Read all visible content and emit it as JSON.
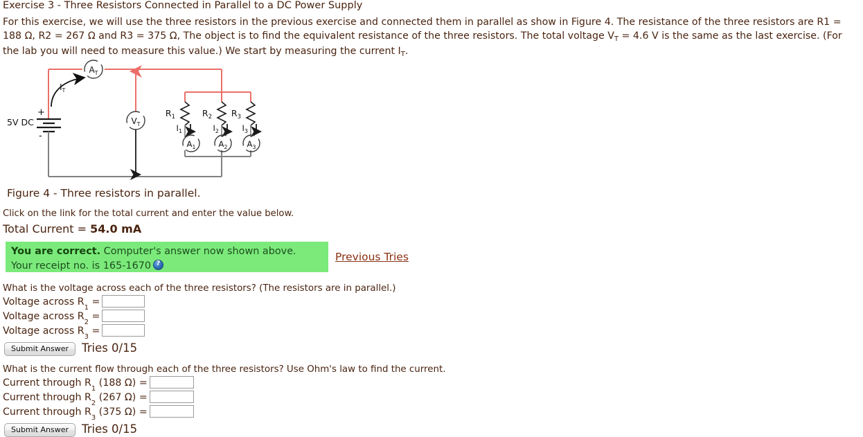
{
  "exercise": {
    "title": "Exercise 3 - Three Resistors Connected in Parallel to a DC Power Supply",
    "intro_part1": "For this exercise, we will use the three resistors in the previous exercise and connected them in parallel as show in Figure 4. The resistance of the three resistors are R1 = 188 Ω, R2 = 267 Ω and R3 = 375 Ω, The object is to find the equivalent resistance of the three resistors. The total voltage V",
    "intro_sub1": "T",
    "intro_part2": " = 4.6 V is the same as the last exercise. (For the lab you will need to measure this value.) We start by measuring the current I",
    "intro_sub2": "T",
    "intro_part3": "."
  },
  "figure": {
    "caption": "Figure 4 - Three resistors in parallel.",
    "supply_label": "5V DC",
    "plus_label": "+",
    "minus_label": "-",
    "total_ammeter_label": "A",
    "total_ammeter_sub": "T",
    "total_current_arrow_label": "I",
    "total_current_arrow_sub": "T",
    "voltmeter_label": "V",
    "voltmeter_sub": "T",
    "resistors": [
      {
        "label": "R",
        "sub": "1",
        "current_label": "I",
        "current_sub": "1",
        "ammeter_label": "A",
        "ammeter_sub": "1"
      },
      {
        "label": "R",
        "sub": "2",
        "current_label": "I",
        "current_sub": "2",
        "ammeter_label": "A",
        "ammeter_sub": "2"
      },
      {
        "label": "R",
        "sub": "3",
        "current_label": "I",
        "current_sub": "3",
        "ammeter_label": "A",
        "ammeter_sub": "3"
      }
    ],
    "wire_color_red": "#ea6f68",
    "wire_color_gray": "#808080",
    "wire_color_black": "#1a1a1a"
  },
  "answered": {
    "instruction": "Click on the link for the total current and enter the value below.",
    "total_current_label": "Total Current = ",
    "total_current_value": "54.0 mA",
    "correct_bold": "You are correct.",
    "correct_rest": " Computer's answer now shown above.",
    "receipt_text": "Your receipt no. is 165-1670",
    "help_icon": "question-mark-icon",
    "previous_tries": "Previous Tries",
    "box_color": "#7bea7b"
  },
  "question1": {
    "prompt": "What is the voltage across each of the three resistors? (The resistors are in parallel.)",
    "rows": [
      {
        "prefix": "Voltage across R",
        "sub": "1",
        "suffix": " =",
        "value": "",
        "placeholder": ""
      },
      {
        "prefix": "Voltage across R",
        "sub": "2",
        "suffix": " =",
        "value": "",
        "placeholder": ""
      },
      {
        "prefix": "Voltage across R",
        "sub": "3",
        "suffix": " =",
        "value": "",
        "placeholder": ""
      }
    ],
    "submit_label": "Submit Answer",
    "tries_label": "Tries 0/15"
  },
  "question2": {
    "prompt": "What is the current flow through each of the three resistors? Use Ohm's law to find the current.",
    "rows": [
      {
        "prefix": "Current through R",
        "sub": "1",
        "suffix": " (188 Ω) =",
        "value": "",
        "placeholder": ""
      },
      {
        "prefix": "Current through R",
        "sub": "2",
        "suffix": " (267 Ω) =",
        "value": "",
        "placeholder": ""
      },
      {
        "prefix": "Current through R",
        "sub": "3",
        "suffix": " (375 Ω) =",
        "value": "",
        "placeholder": ""
      }
    ],
    "submit_label": "Submit Answer",
    "tries_label": "Tries 0/15"
  }
}
